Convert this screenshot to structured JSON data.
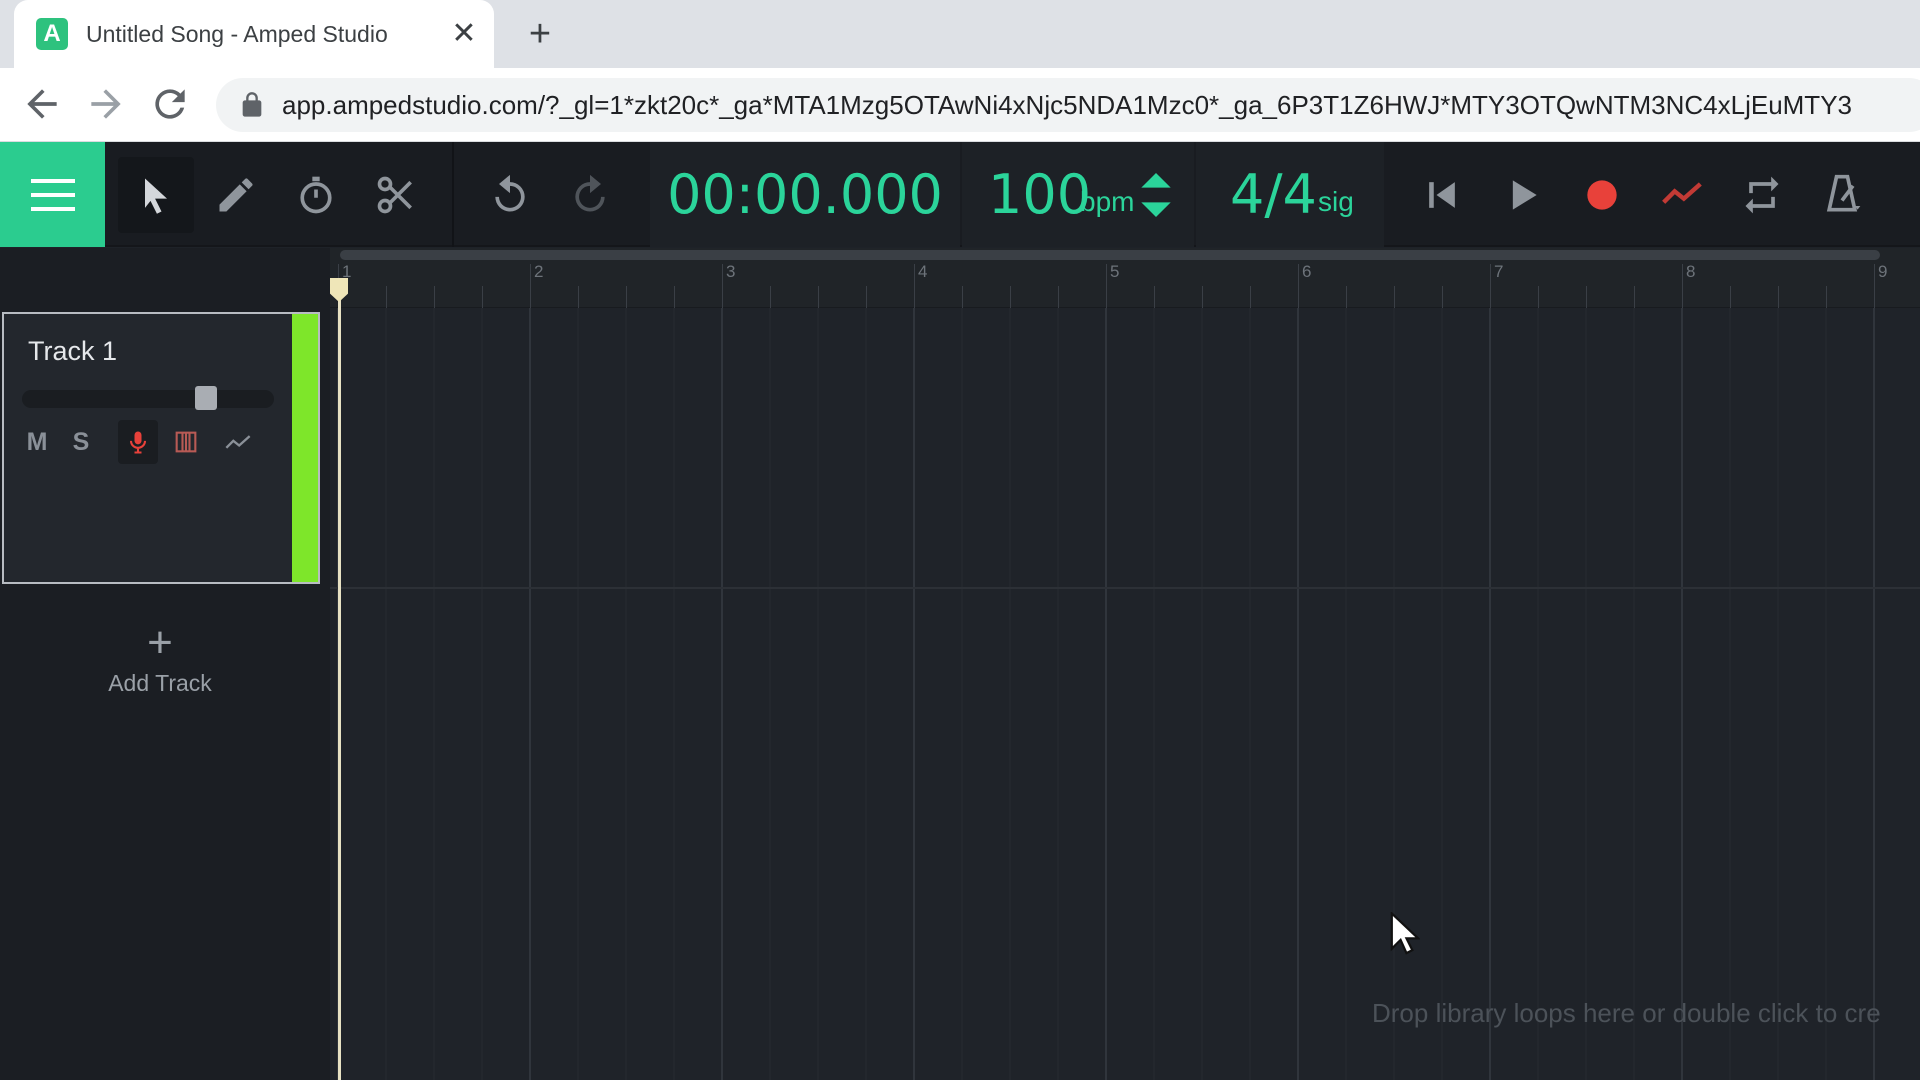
{
  "browser": {
    "tab_title": "Untitled Song - Amped Studio",
    "tab_favicon_letter": "A",
    "tab_close": "✕",
    "new_tab": "+",
    "url": "app.ampedstudio.com/?_gl=1*zkt20c*_ga*MTA1Mzg5OTAwNi4xNjc5NDA1Mzc0*_ga_6P3T1Z6HWJ*MTY3OTQwNTM3NC4xLjEuMTY3"
  },
  "transport": {
    "time": "00:00.000",
    "bpm_value": "100",
    "bpm_unit": "bpm",
    "sig_value": "4/4",
    "sig_unit": "sig"
  },
  "tools": [
    "menu-icon",
    "pointer-icon",
    "pencil-icon",
    "stopwatch-icon",
    "scissors-icon",
    "undo-icon",
    "redo-icon",
    "skip-to-start-icon",
    "play-icon",
    "record-icon",
    "automation-icon",
    "loop-icon",
    "metronome-icon"
  ],
  "tracks": [
    {
      "name": "Track 1",
      "mute": "M",
      "solo": "S",
      "color": "#7ee62a",
      "volume": 0.8
    }
  ],
  "add_track": {
    "plus": "+",
    "label": "Add Track"
  },
  "ruler": {
    "bars": [
      "1",
      "2",
      "3",
      "4",
      "5",
      "6",
      "7",
      "8",
      "9"
    ]
  },
  "timeline": {
    "drop_hint": "Drop library loops here or double click to cre"
  },
  "colors": {
    "accent": "#2bcc8f",
    "transport_text": "#2bd49a",
    "record": "#e8413a",
    "track_color": "#7ee62a"
  }
}
